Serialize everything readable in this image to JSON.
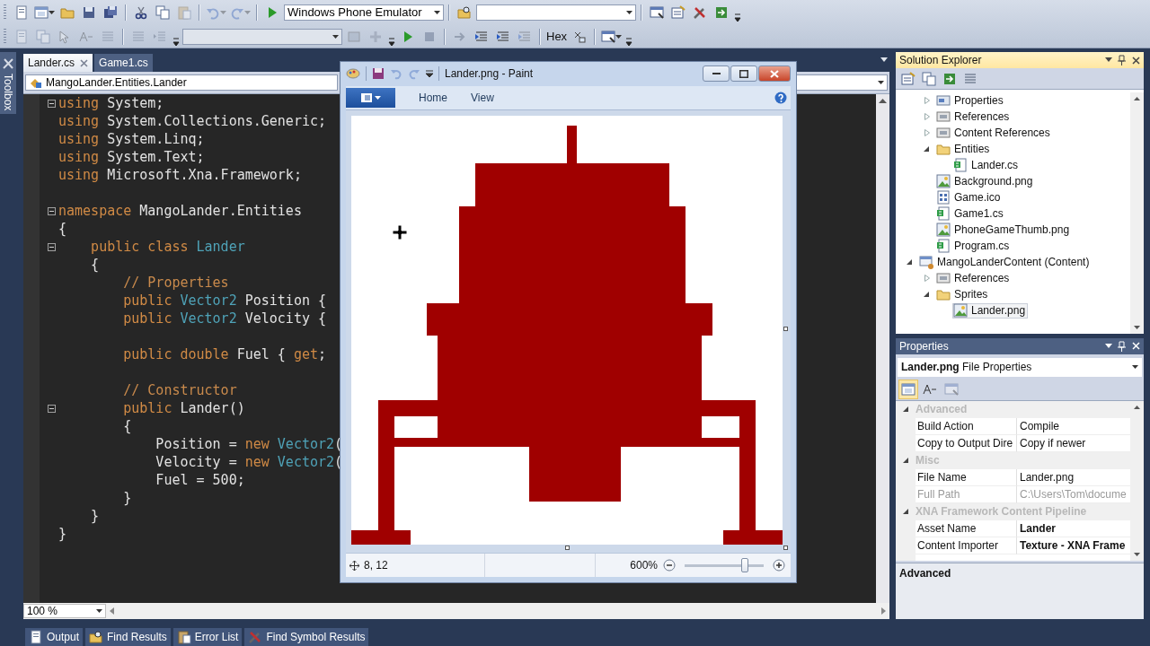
{
  "toolbars": [
    {
      "items": [
        {
          "kind": "button",
          "disabled": false
        },
        {
          "kind": "split",
          "disabled": false
        },
        {
          "kind": "button",
          "disabled": false
        },
        {
          "kind": "button",
          "disabled": false
        },
        {
          "kind": "button",
          "disabled": false
        },
        {
          "kind": "separator"
        },
        {
          "kind": "button",
          "disabled": false
        },
        {
          "kind": "button",
          "disabled": false
        },
        {
          "kind": "button",
          "disabled": true
        },
        {
          "kind": "separator"
        },
        {
          "kind": "split",
          "disabled": true
        },
        {
          "kind": "split",
          "disabled": true
        },
        {
          "kind": "separator"
        },
        {
          "kind": "button",
          "disabled": false
        },
        {
          "kind": "combo",
          "disabled": false,
          "value": "Windows Phone Emulator"
        },
        {
          "kind": "separator"
        },
        {
          "kind": "button",
          "disabled": false
        },
        {
          "kind": "combo",
          "disabled": false
        },
        {
          "kind": "separator"
        },
        {
          "kind": "button",
          "disabled": false
        },
        {
          "kind": "button",
          "disabled": false
        },
        {
          "kind": "button",
          "disabled": false
        },
        {
          "kind": "button",
          "disabled": false
        },
        {
          "kind": "overflow"
        }
      ]
    },
    {
      "items": [
        {
          "kind": "button",
          "disabled": true
        },
        {
          "kind": "button",
          "disabled": true
        },
        {
          "kind": "button",
          "disabled": true
        },
        {
          "kind": "button",
          "disabled": true
        },
        {
          "kind": "button",
          "disabled": true
        },
        {
          "kind": "separator"
        },
        {
          "kind": "button",
          "disabled": true
        },
        {
          "kind": "button",
          "disabled": true
        },
        {
          "kind": "overflow"
        },
        {
          "kind": "combo",
          "disabled": true
        },
        {
          "kind": "button",
          "disabled": true
        },
        {
          "kind": "button",
          "disabled": true
        },
        {
          "kind": "overflow"
        },
        {
          "kind": "button",
          "disabled": false
        },
        {
          "kind": "button",
          "disabled": true
        },
        {
          "kind": "separator"
        },
        {
          "kind": "button",
          "disabled": true
        },
        {
          "kind": "button",
          "disabled": false
        },
        {
          "kind": "button",
          "disabled": false
        },
        {
          "kind": "button",
          "disabled": true
        },
        {
          "kind": "separator"
        },
        {
          "kind": "text",
          "disabled": false,
          "label": "Hex"
        },
        {
          "kind": "button",
          "disabled": false
        },
        {
          "kind": "separator"
        },
        {
          "kind": "split",
          "disabled": false
        },
        {
          "kind": "overflow"
        }
      ]
    }
  ],
  "toolbox": "Toolbox",
  "editor": {
    "tabs": [
      {
        "label": "Lander.cs",
        "selected": true
      },
      {
        "label": "Game1.cs",
        "selected": false
      }
    ],
    "navigation": "MangoLander.Entities.Lander",
    "lines": [
      {
        "fold": true,
        "tokens": [
          {
            "kind": "keyword",
            "text": "using"
          },
          {
            "kind": "plain",
            "text": " System;"
          }
        ]
      },
      {
        "fold": false,
        "tokens": [
          {
            "kind": "keyword",
            "text": "using"
          },
          {
            "kind": "plain",
            "text": " System.Collections.Generic;"
          }
        ]
      },
      {
        "fold": false,
        "tokens": [
          {
            "kind": "keyword",
            "text": "using"
          },
          {
            "kind": "plain",
            "text": " System.Linq;"
          }
        ]
      },
      {
        "fold": false,
        "tokens": [
          {
            "kind": "keyword",
            "text": "using"
          },
          {
            "kind": "plain",
            "text": " System.Text;"
          }
        ]
      },
      {
        "fold": false,
        "tokens": [
          {
            "kind": "keyword",
            "text": "using"
          },
          {
            "kind": "plain",
            "text": " Microsoft.Xna.Framework;"
          }
        ]
      },
      {
        "fold": false
      },
      {
        "fold": true,
        "tokens": [
          {
            "kind": "keyword",
            "text": "namespace"
          },
          {
            "kind": "plain",
            "text": " MangoLander.Entities"
          }
        ]
      },
      {
        "fold": false,
        "tokens": [
          {
            "kind": "plain",
            "text": "{"
          }
        ]
      },
      {
        "fold": true,
        "tokens": [
          {
            "kind": "keyword",
            "text": "    public class"
          },
          {
            "kind": "type",
            "text": " Lander"
          }
        ]
      },
      {
        "fold": false,
        "tokens": [
          {
            "kind": "plain",
            "text": "    {"
          }
        ]
      },
      {
        "fold": false,
        "tokens": [
          {
            "kind": "comment",
            "text": "        // Properties"
          }
        ]
      },
      {
        "fold": false,
        "tokens": [
          {
            "kind": "keyword",
            "text": "        public"
          },
          {
            "kind": "type",
            "text": " Vector2"
          },
          {
            "kind": "plain",
            "text": " Position {"
          }
        ]
      },
      {
        "fold": false,
        "tokens": [
          {
            "kind": "keyword",
            "text": "        public"
          },
          {
            "kind": "type",
            "text": " Vector2"
          },
          {
            "kind": "plain",
            "text": " Velocity {"
          }
        ]
      },
      {
        "fold": false
      },
      {
        "fold": false,
        "tokens": [
          {
            "kind": "keyword",
            "text": "        public double"
          },
          {
            "kind": "plain",
            "text": " Fuel { "
          },
          {
            "kind": "keyword",
            "text": "get"
          },
          {
            "kind": "plain",
            "text": ";"
          }
        ]
      },
      {
        "fold": false
      },
      {
        "fold": false,
        "tokens": [
          {
            "kind": "comment",
            "text": "        // Constructor"
          }
        ]
      },
      {
        "fold": true,
        "tokens": [
          {
            "kind": "keyword",
            "text": "        public"
          },
          {
            "kind": "plain",
            "text": " Lander()"
          }
        ]
      },
      {
        "fold": false,
        "tokens": [
          {
            "kind": "plain",
            "text": "        {"
          }
        ]
      },
      {
        "fold": false,
        "tokens": [
          {
            "kind": "plain",
            "text": "            Position = "
          },
          {
            "kind": "keyword",
            "text": "new"
          },
          {
            "kind": "type",
            "text": " Vector2"
          },
          {
            "kind": "plain",
            "text": "("
          }
        ]
      },
      {
        "fold": false,
        "tokens": [
          {
            "kind": "plain",
            "text": "            Velocity = "
          },
          {
            "kind": "keyword",
            "text": "new"
          },
          {
            "kind": "type",
            "text": " Vector2"
          },
          {
            "kind": "plain",
            "text": "("
          }
        ]
      },
      {
        "fold": false,
        "tokens": [
          {
            "kind": "plain",
            "text": "            Fuel = 500;"
          }
        ]
      },
      {
        "fold": false,
        "tokens": [
          {
            "kind": "plain",
            "text": "        }"
          }
        ]
      },
      {
        "fold": false,
        "tokens": [
          {
            "kind": "plain",
            "text": "    }"
          }
        ]
      },
      {
        "fold": false,
        "tokens": [
          {
            "kind": "plain",
            "text": "}"
          }
        ]
      }
    ],
    "zoom": "100 %"
  },
  "paint": {
    "title": "Lander.png - Paint",
    "quick_access": [
      {
        "disabled": false
      },
      {
        "disabled": true
      },
      {
        "disabled": true
      }
    ],
    "tabs": [
      {
        "label": "Home",
        "selected": false
      },
      {
        "label": "View",
        "selected": false
      }
    ],
    "position": "8, 12",
    "zoom": "600%",
    "level": 0.76
  },
  "solution_explorer": {
    "title": "Solution Explorer",
    "tree": [
      {
        "children": [
          {
            "label": "Properties",
            "kind": "properties",
            "expanded": false,
            "selected": false
          },
          {
            "label": "References",
            "kind": "references",
            "expanded": false,
            "selected": false
          },
          {
            "label": "Content References",
            "kind": "references",
            "expanded": false,
            "selected": false
          },
          {
            "label": "Entities",
            "kind": "folder",
            "expanded": true,
            "selected": false,
            "children": [
              {
                "label": "Lander.cs",
                "kind": "code",
                "selected": false
              }
            ]
          },
          {
            "label": "Background.png",
            "kind": "image",
            "selected": false
          },
          {
            "label": "Game.ico",
            "kind": "icon-file",
            "selected": false
          },
          {
            "label": "Game1.cs",
            "kind": "code",
            "selected": false
          },
          {
            "label": "PhoneGameThumb.png",
            "kind": "image",
            "selected": false
          },
          {
            "label": "Program.cs",
            "kind": "code",
            "selected": false
          }
        ]
      },
      {
        "label": "MangoLanderContent (Content)",
        "kind": "project",
        "expanded": true,
        "selected": false,
        "children": [
          {
            "label": "References",
            "kind": "references",
            "expanded": false,
            "selected": false
          },
          {
            "label": "Sprites",
            "kind": "folder",
            "expanded": true,
            "selected": false,
            "children": [
              {
                "label": "Lander.png",
                "kind": "image",
                "selected": true
              }
            ]
          }
        ]
      }
    ]
  },
  "properties": {
    "title": "Properties",
    "selector": "**Lander.png** File Properties",
    "categories": [
      {
        "label": "Advanced",
        "expanded": true,
        "rows": [
          {
            "name": "Build Action",
            "value": "Compile",
            "modified": false,
            "readonly": false
          },
          {
            "name": "Copy to Output Dire",
            "value": "Copy if newer",
            "modified": false,
            "readonly": false
          }
        ]
      },
      {
        "label": "Misc",
        "expanded": true,
        "rows": [
          {
            "name": "File Name",
            "value": "Lander.png",
            "modified": false,
            "readonly": false
          },
          {
            "name": "Full Path",
            "value": "C:\\Users\\Tom\\docume",
            "modified": false,
            "readonly": true
          }
        ]
      },
      {
        "label": "XNA Framework Content Pipeline",
        "expanded": true,
        "rows": [
          {
            "name": "Asset Name",
            "value": "Lander",
            "modified": true,
            "readonly": false
          },
          {
            "name": "Content Importer",
            "value": "Texture - XNA Frame",
            "modified": true,
            "readonly": false
          }
        ]
      }
    ],
    "description": "Advanced"
  },
  "bottom_tabs": [
    {
      "label": "Output"
    },
    {
      "label": "Find Results"
    },
    {
      "label": "Error List"
    },
    {
      "label": "Find Symbol Results"
    }
  ]
}
